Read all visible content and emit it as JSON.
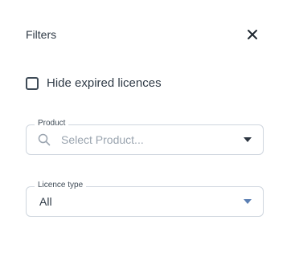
{
  "header": {
    "title": "Filters"
  },
  "hide_expired": {
    "label": "Hide expired licences",
    "checked": false
  },
  "product": {
    "label": "Product",
    "placeholder": "Select Product..."
  },
  "licence_type": {
    "label": "Licence type",
    "value": "All"
  },
  "icons": {
    "close": "close-icon",
    "search": "search-icon",
    "dropdown": "chevron-down-icon"
  },
  "colors": {
    "border": "#cfd6de",
    "text": "#2f3a46",
    "placeholder": "#9aa4af",
    "caret_blue": "#5b7fb3"
  }
}
